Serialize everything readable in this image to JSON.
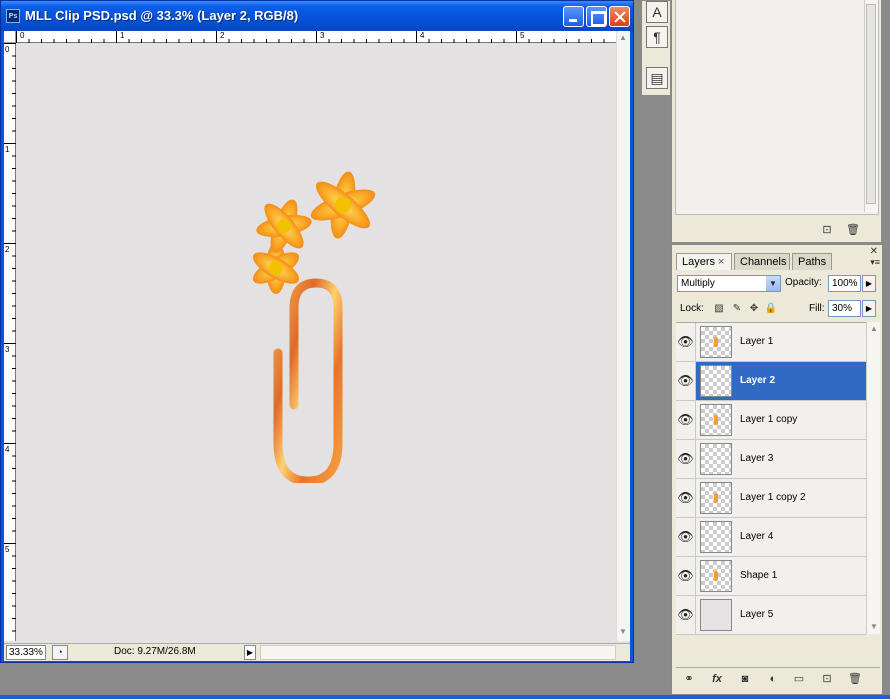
{
  "document": {
    "title": "MLL Clip PSD.psd @ 33.3% (Layer 2, RGB/8)",
    "ps_icon": "Ps",
    "ruler_h": [
      "0",
      "1",
      "2",
      "3",
      "4",
      "5"
    ],
    "ruler_v": [
      "0",
      "1",
      "2",
      "3",
      "4",
      "5"
    ],
    "status": {
      "zoom": "33.33%",
      "doc_info": "Doc: 9.27M/26.8M"
    }
  },
  "tools": [
    "A",
    "¶",
    "▤"
  ],
  "layers_panel": {
    "tabs": [
      {
        "label": "Layers",
        "close": "×"
      },
      {
        "label": "Channels"
      },
      {
        "label": "Paths"
      }
    ],
    "blend_mode": "Multiply",
    "opacity_label": "Opacity:",
    "opacity": "100%",
    "lock_label": "Lock:",
    "fill_label": "Fill:",
    "fill": "30%",
    "layers": [
      {
        "name": "Layer 1",
        "selected": false
      },
      {
        "name": "Layer 2",
        "selected": true
      },
      {
        "name": "Layer 1 copy",
        "selected": false
      },
      {
        "name": "Layer 3",
        "selected": false
      },
      {
        "name": "Layer 1 copy 2",
        "selected": false
      },
      {
        "name": "Layer 4",
        "selected": false
      },
      {
        "name": "Shape 1",
        "selected": false
      },
      {
        "name": "Layer 5",
        "selected": false
      }
    ]
  },
  "icons": {
    "eye": "eye-icon",
    "link": "link-layers-icon",
    "fx": "fx-icon",
    "mask": "add-mask-icon",
    "adjust": "adjustment-layer-icon",
    "folder": "new-group-icon",
    "new": "new-layer-icon",
    "trash": "trash-icon"
  },
  "colors": {
    "selection": "#316ac5",
    "titlebar": "#0452d8",
    "canvas": "#e3e1e1"
  }
}
